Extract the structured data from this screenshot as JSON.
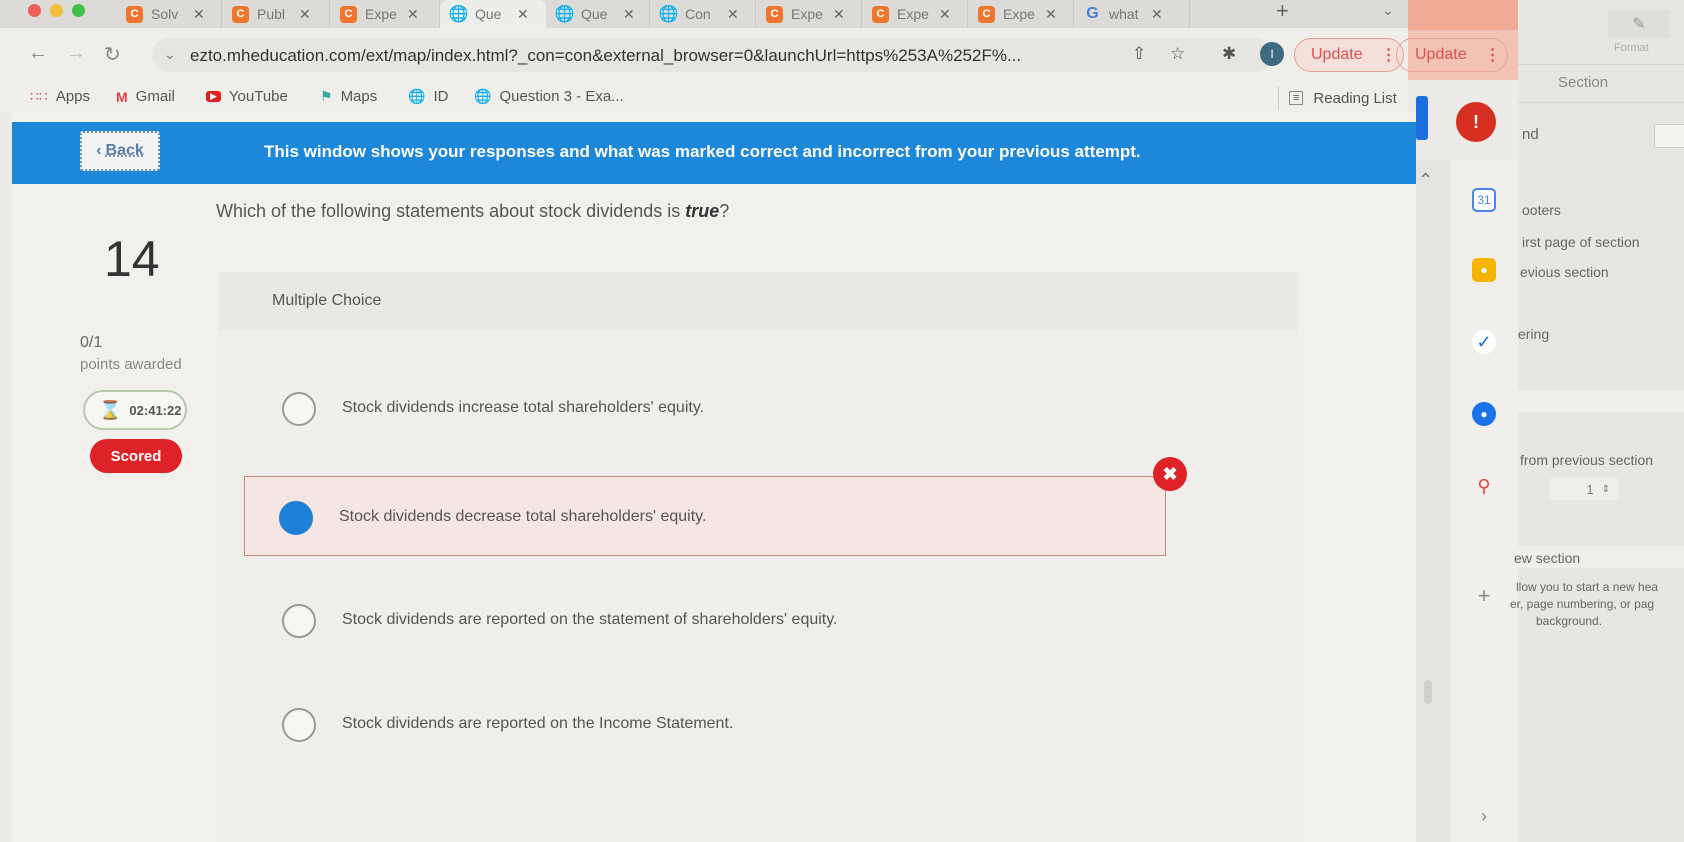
{
  "browser": {
    "tabs": [
      {
        "icon": "chegg-icon",
        "title": "Solv"
      },
      {
        "icon": "chegg-icon",
        "title": "Publ"
      },
      {
        "icon": "chegg-icon",
        "title": "Expe"
      },
      {
        "icon": "globe-icon",
        "title": "Que",
        "active": true
      },
      {
        "icon": "globe-icon",
        "title": "Que"
      },
      {
        "icon": "globe-icon",
        "title": "Con"
      },
      {
        "icon": "chegg-icon",
        "title": "Expe"
      },
      {
        "icon": "chegg-icon",
        "title": "Expe"
      },
      {
        "icon": "chegg-icon",
        "title": "Expe"
      },
      {
        "icon": "google-icon",
        "title": "what"
      }
    ],
    "new_tab": "+",
    "url": "ezto.mheducation.com/ext/map/index.html?_con=con&external_browser=0&launchUrl=https%253A%252F%...",
    "profile_initial": "I",
    "update_label": "Update",
    "bookmarks": [
      {
        "icon": "apps-grid-icon",
        "label": "Apps"
      },
      {
        "icon": "gmail-icon",
        "label": "Gmail"
      },
      {
        "icon": "youtube-icon",
        "label": "YouTube"
      },
      {
        "icon": "maps-icon",
        "label": "Maps"
      },
      {
        "icon": "globe-icon",
        "label": "ID"
      },
      {
        "icon": "globe-icon",
        "label": "Question 3 - Exa..."
      }
    ],
    "reading_list": "Reading List"
  },
  "page": {
    "back_label": "Back",
    "banner": "This window shows your responses and what was marked correct and incorrect from your previous attempt.",
    "question_number": "14",
    "question_prefix": "Which of the following statements about stock dividends is ",
    "question_emph": "true",
    "question_suffix": "?",
    "points": "0/1",
    "points_label": "points awarded",
    "timer": "02:41:22",
    "status": "Scored",
    "question_type": "Multiple Choice",
    "choices": [
      {
        "text": "Stock dividends increase total shareholders' equity.",
        "selected": false,
        "marked": ""
      },
      {
        "text": "Stock dividends decrease total shareholders' equity.",
        "selected": true,
        "marked": "incorrect"
      },
      {
        "text": "Stock dividends are reported on the statement of shareholders' equity.",
        "selected": false,
        "marked": ""
      },
      {
        "text": "Stock dividends are reported on the Income Statement.",
        "selected": false,
        "marked": ""
      }
    ],
    "colors": {
      "banner": "#1d87d9",
      "selected": "#1e7fd6",
      "incorrect": "#dd2328",
      "scored": "#dd2328"
    }
  },
  "background_window": {
    "update_label": "Update",
    "alert": "!",
    "format_label": "Format",
    "section_label": "Section",
    "texts": {
      "t1": "nd",
      "t2": "ooters",
      "t3": "irst page of section",
      "t4": "evious section",
      "t5": "ering",
      "t6": "from previous section",
      "stepper_value": "1",
      "t7": "ew section",
      "t8": "llow you to start a new hea",
      "t9": "er, page numbering, or pag",
      "t10": "background."
    }
  }
}
